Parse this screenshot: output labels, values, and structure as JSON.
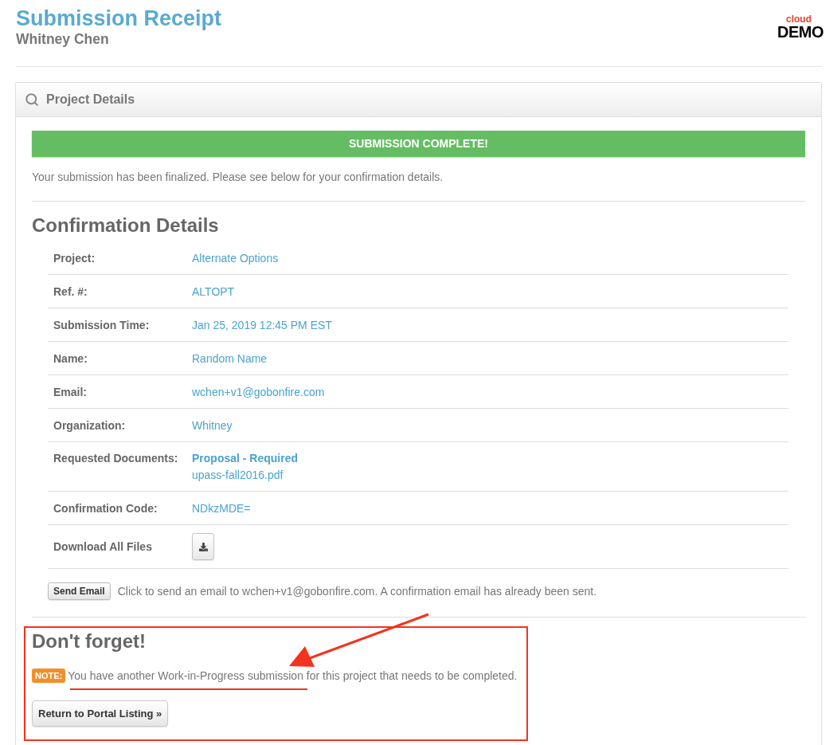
{
  "header": {
    "title": "Submission Receipt",
    "subtitle": "Whitney Chen",
    "logo": {
      "small": "cloud",
      "large": "DEMO"
    }
  },
  "panel": {
    "title": "Project Details"
  },
  "alert": {
    "text": "SUBMISSION COMPLETE!"
  },
  "intro": "Your submission has been finalized. Please see below for your confirmation details.",
  "confirmation": {
    "heading": "Confirmation Details",
    "rows": [
      {
        "kind": "text",
        "label": "Project:",
        "value": "Alternate Options"
      },
      {
        "kind": "text",
        "label": "Ref. #:",
        "value": "ALTOPT"
      },
      {
        "kind": "text",
        "label": "Submission Time:",
        "value": "Jan 25, 2019 12:45 PM EST"
      },
      {
        "kind": "text",
        "label": "Name:",
        "value": "Random Name"
      },
      {
        "kind": "text",
        "label": "Email:",
        "value": "wchen+v1@gobonfire.com"
      },
      {
        "kind": "text",
        "label": "Organization:",
        "value": "Whitney"
      },
      {
        "kind": "documents",
        "label": "Requested Documents:",
        "document": "Proposal - Required",
        "file": "upass-fall2016.pdf"
      },
      {
        "kind": "text",
        "label": "Confirmation Code:",
        "value": "NDkzMDE="
      },
      {
        "kind": "download",
        "label": "Download All Files"
      }
    ]
  },
  "email": {
    "button": "Send Email",
    "text": "Click to send an email to wchen+v1@gobonfire.com. A confirmation email has already been sent."
  },
  "reminder": {
    "heading": "Don't forget!",
    "badge": "NOTE:",
    "text": "You have another Work-in-Progress submission for this project that needs to be completed.",
    "button": "Return to Portal Listing »"
  },
  "annotations": [
    {
      "kind": "box"
    },
    {
      "kind": "arrow"
    },
    {
      "kind": "underline"
    }
  ]
}
